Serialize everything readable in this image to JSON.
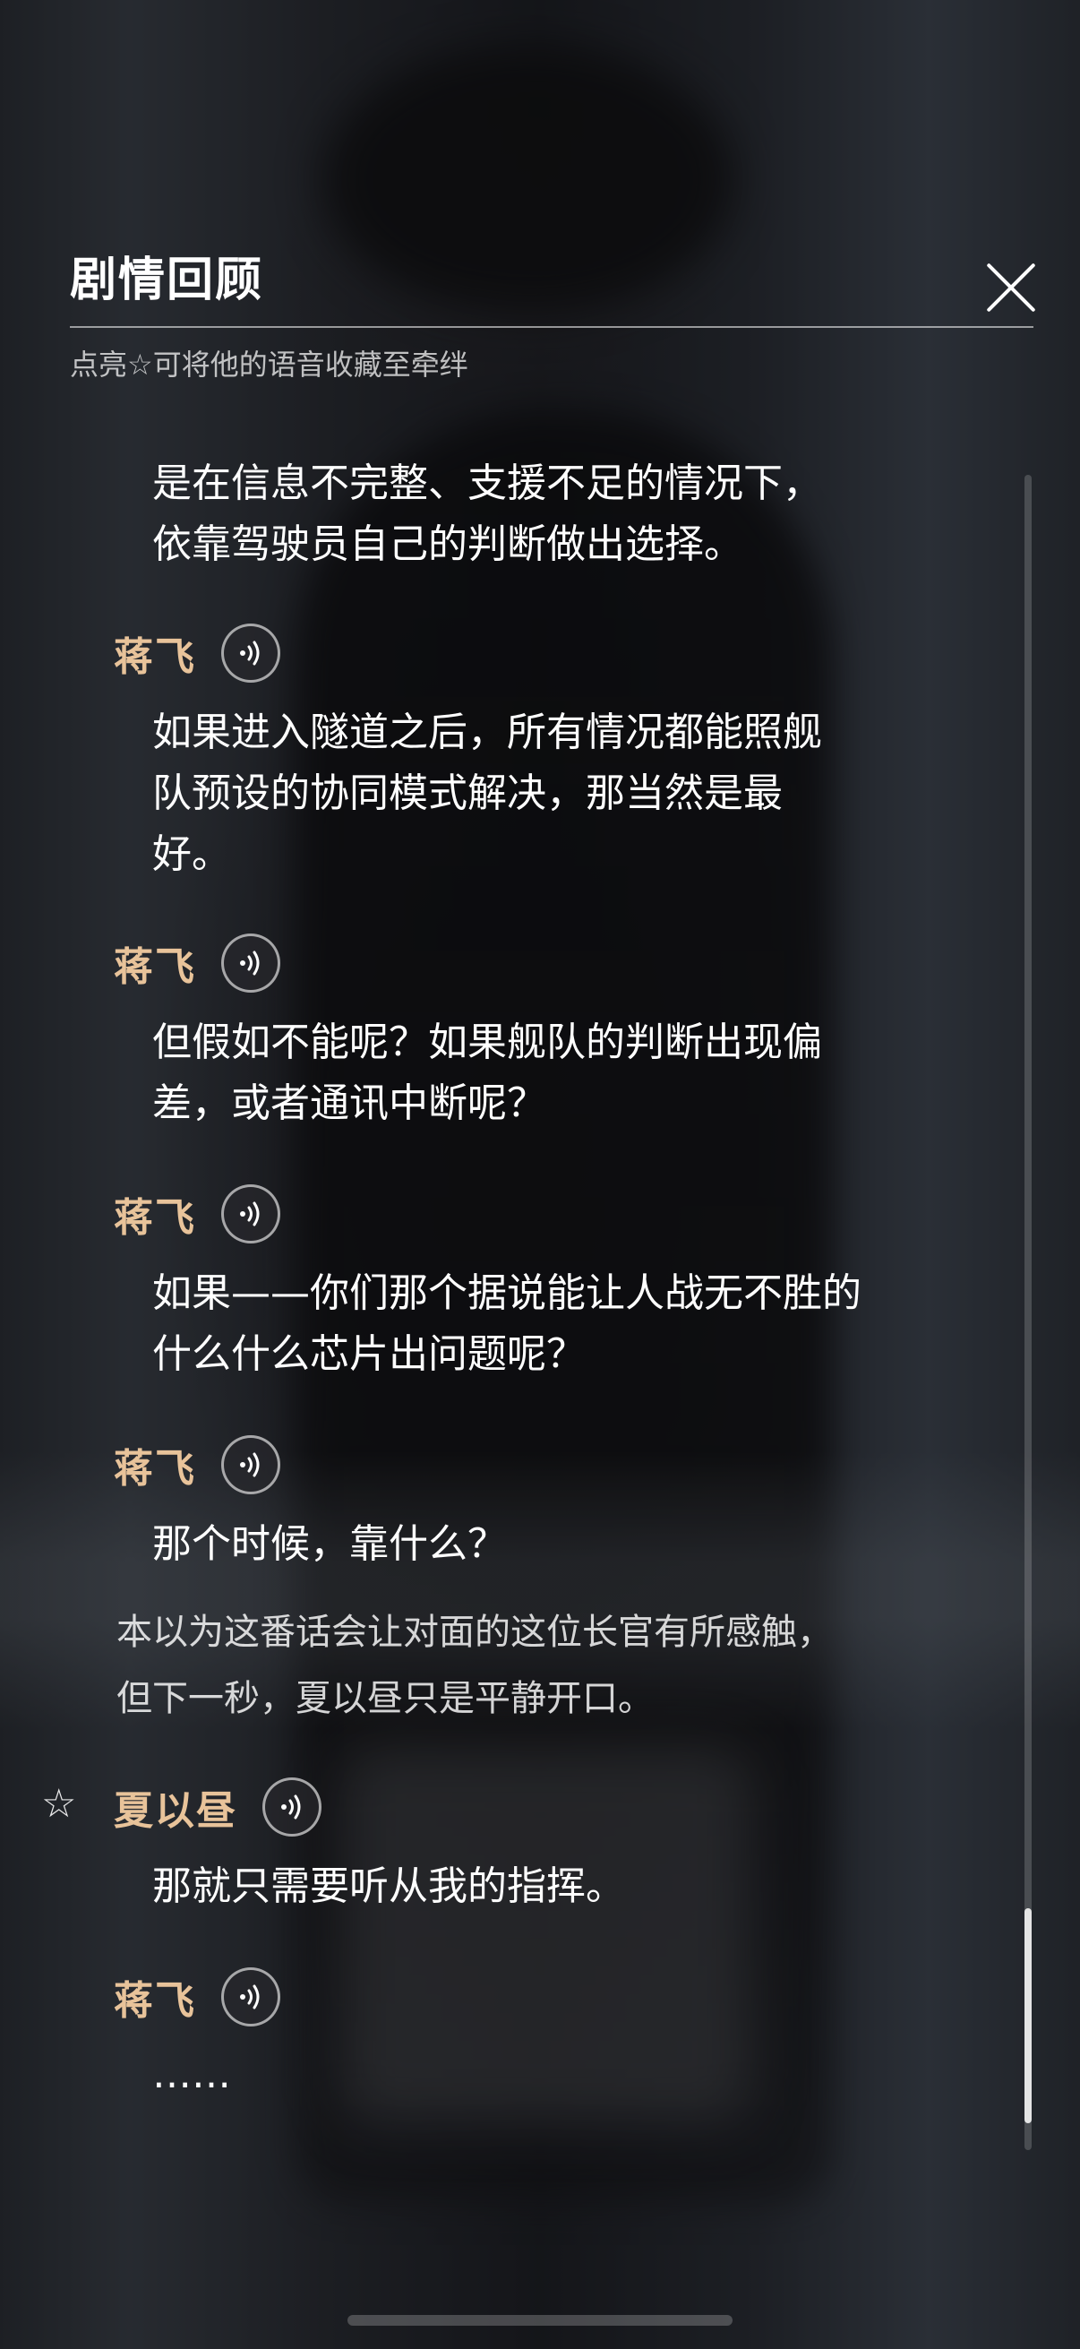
{
  "header": {
    "title": "剧情回顾",
    "subtitle": "点亮☆可将他的语音收藏至牵绊"
  },
  "icons": {
    "close": "close-icon",
    "voice": "sound-wave-icon",
    "favorite": "star-outline-icon"
  },
  "colors": {
    "speaker_name": "#e8c39a",
    "text": "#ffffff"
  },
  "dialogue": {
    "prev_line_1": "是在信息不完整、支援不足的情况下，",
    "prev_line_2": "依靠驾驶员自己的判断做出选择。",
    "entries": [
      {
        "speaker": "蒋飞",
        "lines": [
          "如果进入隧道之后，所有情况都能照舰",
          "队预设的协同模式解决，那当然是最",
          "好。"
        ]
      },
      {
        "speaker": "蒋飞",
        "lines": [
          "但假如不能呢？如果舰队的判断出现偏",
          "差，或者通讯中断呢？"
        ]
      },
      {
        "speaker": "蒋飞",
        "lines": [
          "如果——你们那个据说能让人战无不胜的",
          "什么什么芯片出问题呢？"
        ]
      },
      {
        "speaker": "蒋飞",
        "lines": [
          "那个时候，靠什么？"
        ]
      },
      {
        "speaker": "夏以昼",
        "lines": [
          "那就只需要听从我的指挥。"
        ]
      },
      {
        "speaker": "蒋飞",
        "lines": [
          "……"
        ]
      }
    ],
    "narration_1": "本以为这番话会让对面的这位长官有所感触，",
    "narration_2": "但下一秒，夏以昼只是平静开口。"
  }
}
